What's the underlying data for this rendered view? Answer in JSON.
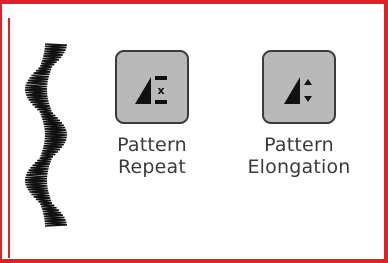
{
  "panel": {
    "border_color": "#e41e26"
  },
  "stitch_preview": {
    "icon": "serpentine-satin-stitch"
  },
  "buttons": [
    {
      "id": "pattern-repeat",
      "icon": "pattern-repeat-icon",
      "label_line1": "Pattern",
      "label_line2": "Repeat"
    },
    {
      "id": "pattern-elongation",
      "icon": "pattern-elongation-icon",
      "label_line1": "Pattern",
      "label_line2": "Elongation"
    }
  ],
  "repeat_icon_glyph": "x"
}
